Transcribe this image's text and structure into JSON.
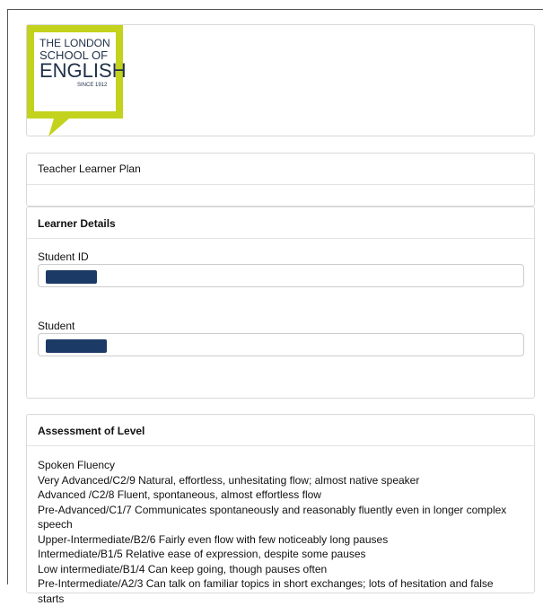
{
  "logo": {
    "line1": "THE LONDON",
    "line2": "SCHOOL OF",
    "line3": "ENGLISH",
    "since": "SINCE 1912",
    "brand_color": "#c3d21c"
  },
  "plan": {
    "title": "Teacher Learner Plan"
  },
  "learner_details": {
    "heading": "Learner Details",
    "student_id_label": "Student ID",
    "student_label": "Student"
  },
  "assessment": {
    "heading": "Assessment of Level",
    "lines": [
      "Spoken Fluency",
      "Very Advanced/C2/9 Natural, effortless, unhesitating flow; almost native speaker",
      "Advanced /C2/8   Fluent, spontaneous, almost effortless flow",
      "Pre-Advanced/C1/7   Communicates spontaneously and reasonably fluently even in longer complex speech",
      "Upper-Intermediate/B2/6     Fairly even flow with few noticeably long pauses",
      "Intermediate/B1/5  Relative ease of expression, despite some pauses",
      "Low intermediate/B1/4  Can keep going, though pauses often",
      "Pre-Intermediate/A2/3  Can talk on familiar topics in short exchanges; lots of hesitation and false starts"
    ]
  }
}
